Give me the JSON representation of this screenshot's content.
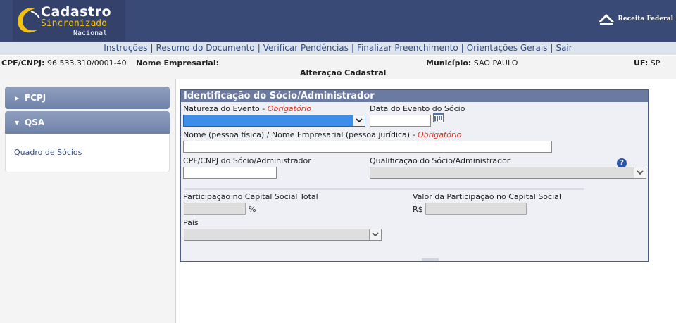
{
  "header": {
    "logo_line1": "Cadastro",
    "logo_line2": "Sincronizado",
    "logo_line3": "Nacional",
    "rf_logo_text": "Receita Federal"
  },
  "nav": {
    "items": [
      "Instruções",
      "Resumo do Documento",
      "Verificar Pendências",
      "Finalizar Preenchimento",
      "Orientações Gerais",
      "Sair"
    ]
  },
  "infobar": {
    "cpf_label": "CPF/CNPJ:",
    "cpf_value": "96.533.310/0001-40",
    "nome_label": "Nome Empresarial:",
    "nome_value": "",
    "municipio_label": "Município:",
    "municipio_value": "SAO PAULO",
    "uf_label": "UF:",
    "uf_value": "SP",
    "title": "Alteração Cadastral"
  },
  "sidebar": {
    "fcpj": "FCPJ",
    "qsa": "QSA",
    "quadro_link": "Quadro de Sócios"
  },
  "form": {
    "title": "Identificação do Sócio/Administrador",
    "natureza_label": "Natureza do Evento - ",
    "required": "Obrigatório",
    "natureza_value": "",
    "data_label": "Data do Evento do Sócio",
    "data_value": "",
    "nome_label": "Nome (pessoa física) / Nome Empresarial (pessoa jurídica) - ",
    "nome_value": "",
    "cpf_label": "CPF/CNPJ do Sócio/Administrador",
    "cpf_value": "",
    "qualificacao_label": "Qualificação do Sócio/Administrador",
    "qualificacao_value": "",
    "participacao_label": "Participação no Capital Social Total",
    "participacao_unit": "%",
    "valor_label": "Valor da Participação no Capital Social",
    "valor_unit": "R$",
    "pais_label": "País",
    "pais_value": ""
  }
}
